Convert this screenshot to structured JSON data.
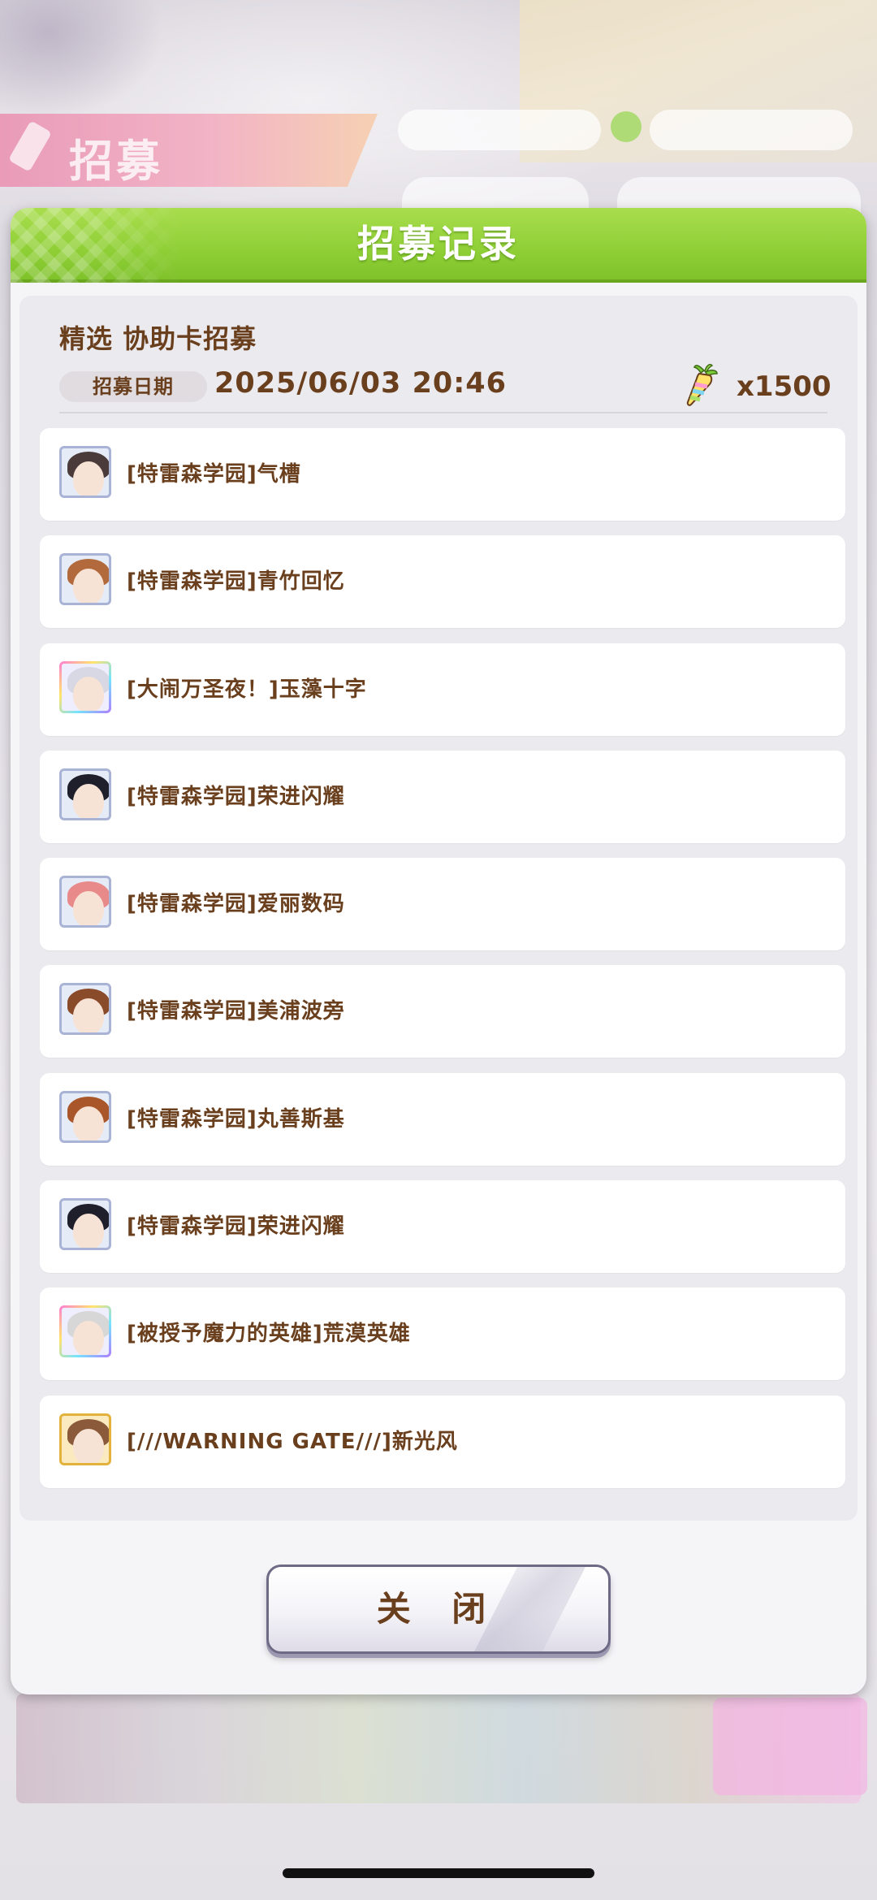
{
  "modal": {
    "title": "招募记录",
    "record_title": "精选 协助卡招募",
    "date_label": "招募日期",
    "date_value": "2025/06/03  20:46",
    "cost_icon": "carrot-icon",
    "cost_value": "x1500",
    "close_label": "关 闭"
  },
  "items": [
    {
      "label": "[特雷森学园]气槽",
      "rarity": "SR",
      "frame": "#a9b3d6",
      "hair": "#4a3a3a"
    },
    {
      "label": "[特雷森学园]青竹回忆",
      "rarity": "SR",
      "frame": "#a9b3d6",
      "hair": "#b26a3c"
    },
    {
      "label": "[大闹万圣夜！]玉藻十字",
      "rarity": "SSR",
      "frame": "rainbow",
      "hair": "#d8d8e4"
    },
    {
      "label": "[特雷森学园]荣进闪耀",
      "rarity": "SR",
      "frame": "#a9b3d6",
      "hair": "#1f1f2c"
    },
    {
      "label": "[特雷森学园]爱丽数码",
      "rarity": "SR",
      "frame": "#a9b3d6",
      "hair": "#e98a8a"
    },
    {
      "label": "[特雷森学园]美浦波旁",
      "rarity": "SR",
      "frame": "#a9b3d6",
      "hair": "#8a4b2a"
    },
    {
      "label": "[特雷森学园]丸善斯基",
      "rarity": "SR",
      "frame": "#a9b3d6",
      "hair": "#a8562a"
    },
    {
      "label": "[特雷森学园]荣进闪耀",
      "rarity": "SR",
      "frame": "#a9b3d6",
      "hair": "#1f1f2c"
    },
    {
      "label": "[被授予魔力的英雄]荒漠英雄",
      "rarity": "SSR",
      "frame": "rainbow",
      "hair": "#d7d7d7"
    },
    {
      "label": "[///WARNING GATE///]新光风",
      "rarity": "SSR",
      "frame": "gold",
      "hair": "#8a5a3a"
    }
  ],
  "background": {
    "banner_text": "招募"
  }
}
